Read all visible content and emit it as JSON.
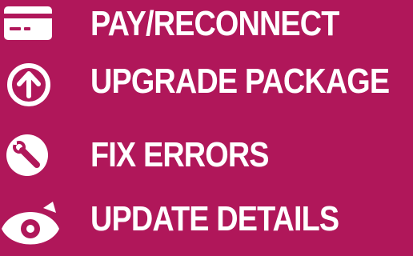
{
  "colors": {
    "background": "#b0175a",
    "foreground": "#ffffff"
  },
  "menu": {
    "items": [
      {
        "label": "PAY/RECONNECT",
        "icon": "credit-card-icon"
      },
      {
        "label": "UPGRADE PACKAGE",
        "icon": "upgrade-arrow-icon"
      },
      {
        "label": "FIX ERRORS",
        "icon": "wrench-icon"
      },
      {
        "label": "UPDATE DETAILS",
        "icon": "eye-icon"
      }
    ]
  }
}
